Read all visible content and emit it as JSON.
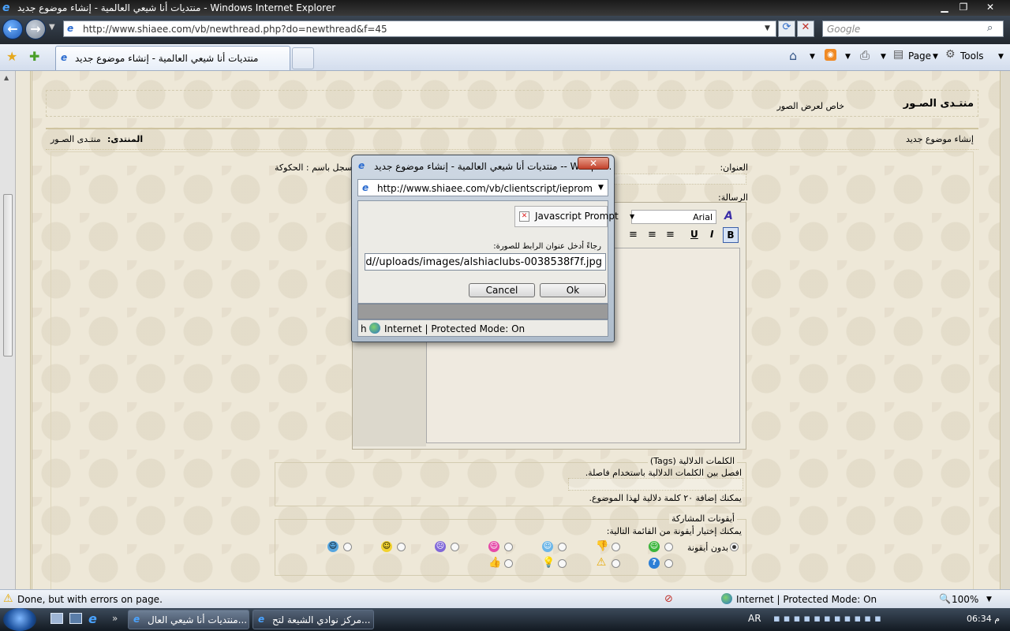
{
  "window": {
    "title": "منتديات أنا شيعي العالمية - إنشاء موضوع جديد - Windows Internet Explorer",
    "minimize": "▁",
    "maximize": "❐",
    "close": "✕"
  },
  "addressbar": {
    "url": "http://www.shiaee.com/vb/newthread.php?do=newthread&f=45",
    "search_placeholder": "Google"
  },
  "tabs": {
    "active_label": "منتديات أنا شيعي العالمية - إنشاء موضوع جديد"
  },
  "commandbar": {
    "page_label": "Page",
    "tools_label": "Tools"
  },
  "page": {
    "forum_title": "منتـدى الصـور",
    "forum_desc": "خاص لعرض الصور",
    "new_thread_link": "إنشاء موضوع جديد",
    "forum_label": "المنتدى:",
    "forum_name": "منتـدى الصـور",
    "title_label": "العنوان:",
    "posting_as": "سجل باسم : الحكوكة",
    "message_label": "الرسالة:",
    "font_value": "Arial",
    "tags_legend": "الكلمات الدلالية (Tags)",
    "tags_hint": "افصل بين الكلمات الدلالية باستخدام فاصلة.",
    "tags_limit": "يمكنك إضافة ٢٠ كلمة دلالية لهذا الموضوع.",
    "icons_legend": "أيقونات المشاركة",
    "icons_hint": "يمكنك إختيار أيقونة من القائمة التالية:",
    "no_icon_label": "بدون أيقونة"
  },
  "dialog": {
    "title": "منتديات أنا شيعي العالمية - إنشاء موضوع جديد -- Webpa...",
    "url": "http://www.shiaee.com/vb/clientscript/ieprompt.ht",
    "prompt_title": "Javascript Prompt",
    "label": "رجاءً أدخل عنوان الرابط للصورة:",
    "input_value": "d//uploads/images/alshiaclubs-0038538f7f.jpg",
    "cancel_label": "Cancel",
    "ok_label": "Ok",
    "status_prefix": "h",
    "status_text": "Internet | Protected Mode: On"
  },
  "statusbar": {
    "message": "Done, but with errors on page.",
    "zone": "Internet | Protected Mode: On",
    "zoom": "100%"
  },
  "taskbar": {
    "task1": "منتديات أنا شيعي العال...",
    "task2": "مركز نوادي الشيعة لتح...",
    "lang": "AR",
    "clock": "06:34 م"
  }
}
